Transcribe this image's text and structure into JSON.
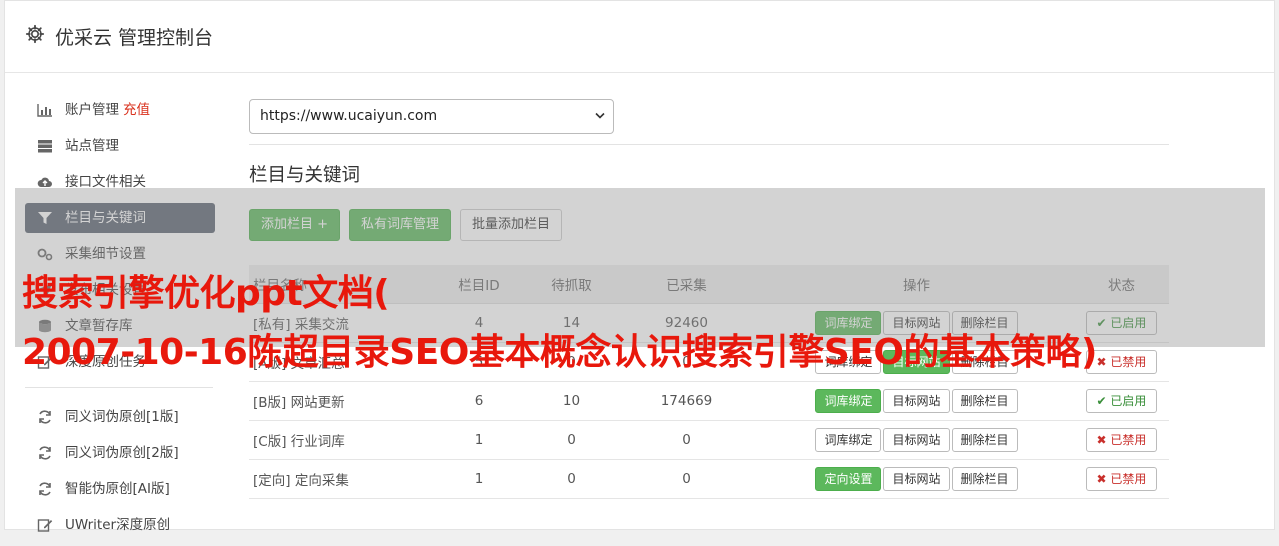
{
  "header": {
    "title": "优采云 管理控制台",
    "icon": "gear-icon"
  },
  "sidebar": {
    "items": [
      {
        "label": "账户管理",
        "extra": "充值",
        "icon": "bar-chart-icon"
      },
      {
        "label": "站点管理",
        "icon": "server-icon"
      },
      {
        "label": "接口文件相关",
        "icon": "cloud-upload-icon"
      },
      {
        "label": "栏目与关键词",
        "icon": "filter-icon",
        "active": true
      },
      {
        "label": "采集细节设置",
        "icon": "gears-icon"
      },
      {
        "label": "发布相关设置",
        "icon": "send-icon"
      },
      {
        "label": "文章暂存库",
        "icon": "database-icon"
      },
      {
        "label": "深度原创任务",
        "icon": "edit-icon"
      }
    ],
    "items2": [
      {
        "label": "同义词伪原创[1版]",
        "icon": "refresh-icon"
      },
      {
        "label": "同义词伪原创[2版]",
        "icon": "refresh-icon"
      },
      {
        "label": "智能伪原创[AI版]",
        "icon": "refresh-icon"
      },
      {
        "label": "UWriter深度原创",
        "icon": "edit-icon"
      }
    ]
  },
  "main": {
    "site_select": {
      "value": "https://www.ucaiyun.com"
    },
    "section_title": "栏目与关键词",
    "buttons": {
      "add": "添加栏目 +",
      "private": "私有词库管理",
      "batch": "批量添加栏目"
    },
    "table": {
      "headers": [
        "栏目名称",
        "栏目ID",
        "待抓取",
        "已采集",
        "操作",
        "状态"
      ],
      "rows": [
        {
          "tag": "[私有]",
          "name": "采集交流",
          "id": "4",
          "pending": "14",
          "collected": "92460",
          "op1": "词库绑定",
          "op2": "目标网站",
          "op3": "删除栏目",
          "status": "已启用",
          "on": true
        },
        {
          "tag": "[A版]",
          "name": "文章汇总",
          "id": "5",
          "pending": "0",
          "collected": "0",
          "op1": "词库绑定",
          "op2": "目标网站",
          "op3": "删除栏目",
          "status": "已禁用",
          "on": false
        },
        {
          "tag": "[B版]",
          "name": "网站更新",
          "id": "6",
          "pending": "10",
          "collected": "174669",
          "op1": "词库绑定",
          "op2": "目标网站",
          "op3": "删除栏目",
          "status": "已启用",
          "on": true
        },
        {
          "tag": "[C版]",
          "name": "行业词库",
          "id": "1",
          "pending": "0",
          "collected": "0",
          "op1": "词库绑定",
          "op2": "目标网站",
          "op3": "删除栏目",
          "status": "已禁用",
          "on": false
        },
        {
          "tag": "[定向]",
          "name": "定向采集",
          "id": "1",
          "pending": "0",
          "collected": "0",
          "op1": "定向设置",
          "op2": "目标网站",
          "op3": "删除栏目",
          "status": "已禁用",
          "on": false
        }
      ]
    }
  },
  "watermark": {
    "line1": "搜索引擎优化ppt文档(",
    "line2": "2007-10-16陈超目录SEO基本概念认识搜索引擎SEO的基本策略)"
  },
  "colors": {
    "accent_green": "#5cb85c",
    "active_nav": "#5b6270",
    "watermark_red": "#e8180c",
    "recharge_red": "#d9301c"
  }
}
